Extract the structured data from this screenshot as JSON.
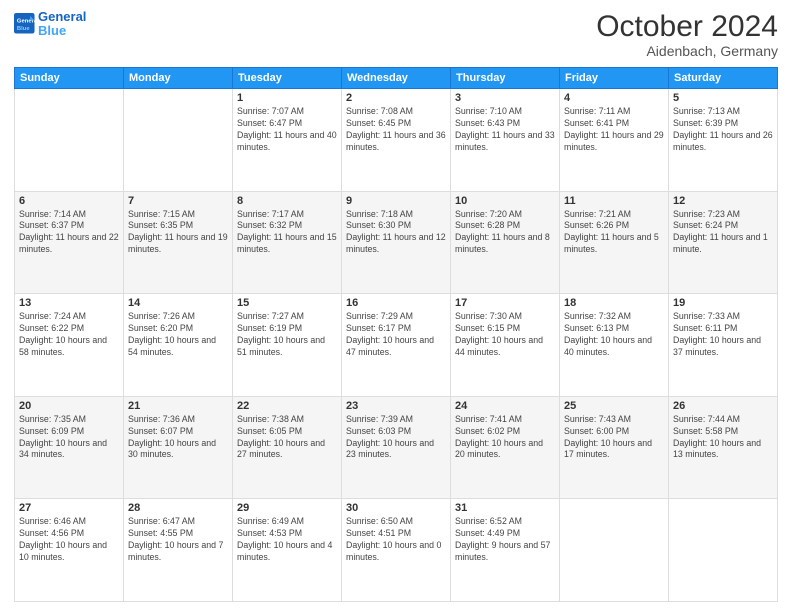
{
  "logo": {
    "line1": "General",
    "line2": "Blue"
  },
  "title": "October 2024",
  "subtitle": "Aidenbach, Germany",
  "weekdays": [
    "Sunday",
    "Monday",
    "Tuesday",
    "Wednesday",
    "Thursday",
    "Friday",
    "Saturday"
  ],
  "weeks": [
    [
      {
        "day": null
      },
      {
        "day": null
      },
      {
        "day": "1",
        "sunrise": "7:07 AM",
        "sunset": "6:47 PM",
        "daylight": "11 hours and 40 minutes."
      },
      {
        "day": "2",
        "sunrise": "7:08 AM",
        "sunset": "6:45 PM",
        "daylight": "11 hours and 36 minutes."
      },
      {
        "day": "3",
        "sunrise": "7:10 AM",
        "sunset": "6:43 PM",
        "daylight": "11 hours and 33 minutes."
      },
      {
        "day": "4",
        "sunrise": "7:11 AM",
        "sunset": "6:41 PM",
        "daylight": "11 hours and 29 minutes."
      },
      {
        "day": "5",
        "sunrise": "7:13 AM",
        "sunset": "6:39 PM",
        "daylight": "11 hours and 26 minutes."
      }
    ],
    [
      {
        "day": "6",
        "sunrise": "7:14 AM",
        "sunset": "6:37 PM",
        "daylight": "11 hours and 22 minutes."
      },
      {
        "day": "7",
        "sunrise": "7:15 AM",
        "sunset": "6:35 PM",
        "daylight": "11 hours and 19 minutes."
      },
      {
        "day": "8",
        "sunrise": "7:17 AM",
        "sunset": "6:32 PM",
        "daylight": "11 hours and 15 minutes."
      },
      {
        "day": "9",
        "sunrise": "7:18 AM",
        "sunset": "6:30 PM",
        "daylight": "11 hours and 12 minutes."
      },
      {
        "day": "10",
        "sunrise": "7:20 AM",
        "sunset": "6:28 PM",
        "daylight": "11 hours and 8 minutes."
      },
      {
        "day": "11",
        "sunrise": "7:21 AM",
        "sunset": "6:26 PM",
        "daylight": "11 hours and 5 minutes."
      },
      {
        "day": "12",
        "sunrise": "7:23 AM",
        "sunset": "6:24 PM",
        "daylight": "11 hours and 1 minute."
      }
    ],
    [
      {
        "day": "13",
        "sunrise": "7:24 AM",
        "sunset": "6:22 PM",
        "daylight": "10 hours and 58 minutes."
      },
      {
        "day": "14",
        "sunrise": "7:26 AM",
        "sunset": "6:20 PM",
        "daylight": "10 hours and 54 minutes."
      },
      {
        "day": "15",
        "sunrise": "7:27 AM",
        "sunset": "6:19 PM",
        "daylight": "10 hours and 51 minutes."
      },
      {
        "day": "16",
        "sunrise": "7:29 AM",
        "sunset": "6:17 PM",
        "daylight": "10 hours and 47 minutes."
      },
      {
        "day": "17",
        "sunrise": "7:30 AM",
        "sunset": "6:15 PM",
        "daylight": "10 hours and 44 minutes."
      },
      {
        "day": "18",
        "sunrise": "7:32 AM",
        "sunset": "6:13 PM",
        "daylight": "10 hours and 40 minutes."
      },
      {
        "day": "19",
        "sunrise": "7:33 AM",
        "sunset": "6:11 PM",
        "daylight": "10 hours and 37 minutes."
      }
    ],
    [
      {
        "day": "20",
        "sunrise": "7:35 AM",
        "sunset": "6:09 PM",
        "daylight": "10 hours and 34 minutes."
      },
      {
        "day": "21",
        "sunrise": "7:36 AM",
        "sunset": "6:07 PM",
        "daylight": "10 hours and 30 minutes."
      },
      {
        "day": "22",
        "sunrise": "7:38 AM",
        "sunset": "6:05 PM",
        "daylight": "10 hours and 27 minutes."
      },
      {
        "day": "23",
        "sunrise": "7:39 AM",
        "sunset": "6:03 PM",
        "daylight": "10 hours and 23 minutes."
      },
      {
        "day": "24",
        "sunrise": "7:41 AM",
        "sunset": "6:02 PM",
        "daylight": "10 hours and 20 minutes."
      },
      {
        "day": "25",
        "sunrise": "7:43 AM",
        "sunset": "6:00 PM",
        "daylight": "10 hours and 17 minutes."
      },
      {
        "day": "26",
        "sunrise": "7:44 AM",
        "sunset": "5:58 PM",
        "daylight": "10 hours and 13 minutes."
      }
    ],
    [
      {
        "day": "27",
        "sunrise": "6:46 AM",
        "sunset": "4:56 PM",
        "daylight": "10 hours and 10 minutes."
      },
      {
        "day": "28",
        "sunrise": "6:47 AM",
        "sunset": "4:55 PM",
        "daylight": "10 hours and 7 minutes."
      },
      {
        "day": "29",
        "sunrise": "6:49 AM",
        "sunset": "4:53 PM",
        "daylight": "10 hours and 4 minutes."
      },
      {
        "day": "30",
        "sunrise": "6:50 AM",
        "sunset": "4:51 PM",
        "daylight": "10 hours and 0 minutes."
      },
      {
        "day": "31",
        "sunrise": "6:52 AM",
        "sunset": "4:49 PM",
        "daylight": "9 hours and 57 minutes."
      },
      {
        "day": null
      },
      {
        "day": null
      }
    ]
  ],
  "labels": {
    "sunrise": "Sunrise:",
    "sunset": "Sunset:",
    "daylight": "Daylight:"
  }
}
